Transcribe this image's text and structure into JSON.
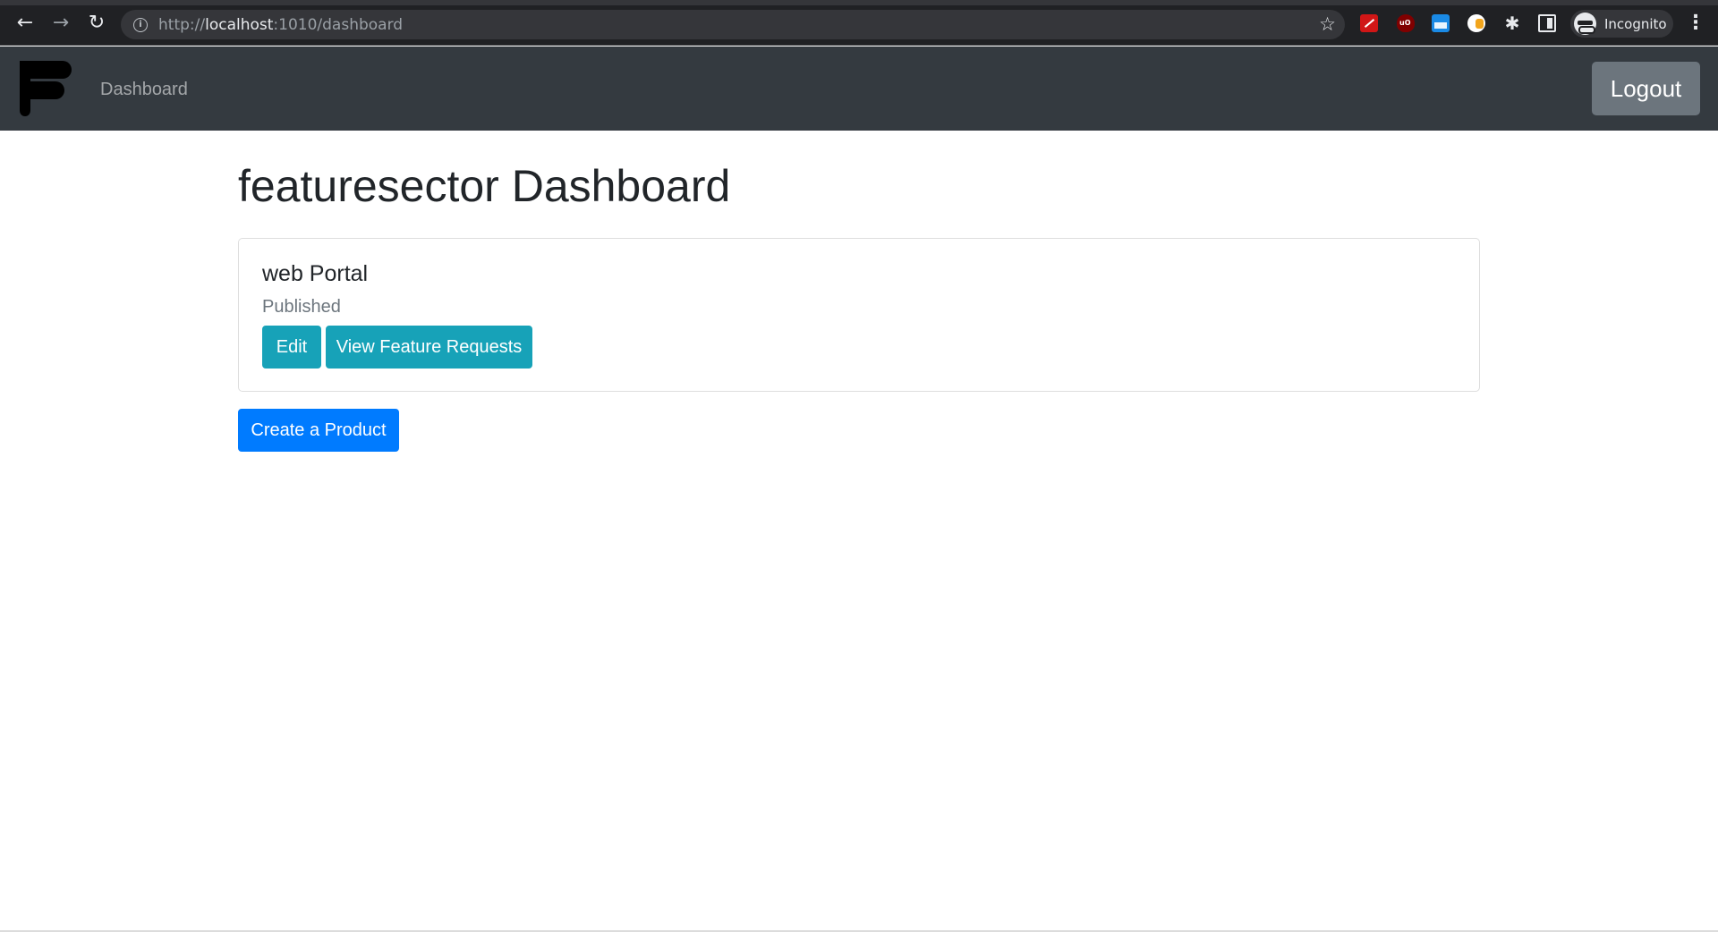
{
  "browser": {
    "url_prefix": "http://",
    "url_host": "localhost",
    "url_rest": ":1010/dashboard",
    "profile_label": "Incognito",
    "icons": {
      "back": "←",
      "forward": "→",
      "reload": "↻",
      "site_info": "i",
      "bookmark": "☆",
      "extensions": "✱",
      "menu": "⋮"
    }
  },
  "navbar": {
    "nav_link": "Dashboard",
    "logout_label": "Logout"
  },
  "main": {
    "title": "featuresector Dashboard",
    "product": {
      "name": "web Portal",
      "status": "Published",
      "edit_label": "Edit",
      "view_requests_label": "View Feature Requests"
    },
    "create_label": "Create a Product"
  },
  "colors": {
    "navbar_bg": "#343a40",
    "info_button": "#17a2b8",
    "primary_button": "#007bff",
    "secondary_button": "#6c757d"
  }
}
